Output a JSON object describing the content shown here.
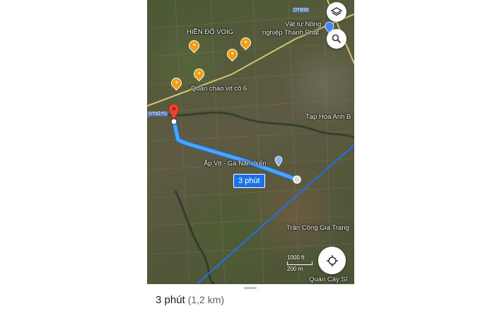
{
  "map": {
    "labels": {
      "dt833": "DT833",
      "store_name_1": "Vật tư Nông",
      "store_name_2": "nghiệp Thành Phát",
      "hien_do": "HIỀN ĐỔ VOIG",
      "quan_chao": "Quán cháo vịt cô 6",
      "dt827d": "DT827D",
      "tap_hoa": "Tạp Hóa Anh B",
      "ap_vit": "Ấp Vịt - Gà Năm Yến",
      "tran_cong": "Trần Công Gia Trang",
      "quan_cay": "Quán Cây Sĩ"
    },
    "route_eta_label": "3 phút",
    "scale": {
      "ft": "1000 ft",
      "m": "200 m"
    },
    "route_color": "#4fa3f7",
    "transit_line_color": "#1a73e8",
    "destination_pin_color": "#ea4335"
  },
  "controls": {
    "layers_icon": "layers-icon",
    "search_icon": "search-icon",
    "locate_icon": "my-location-icon"
  },
  "sheet": {
    "eta": "3 phút",
    "distance": "(1,2 km)"
  }
}
